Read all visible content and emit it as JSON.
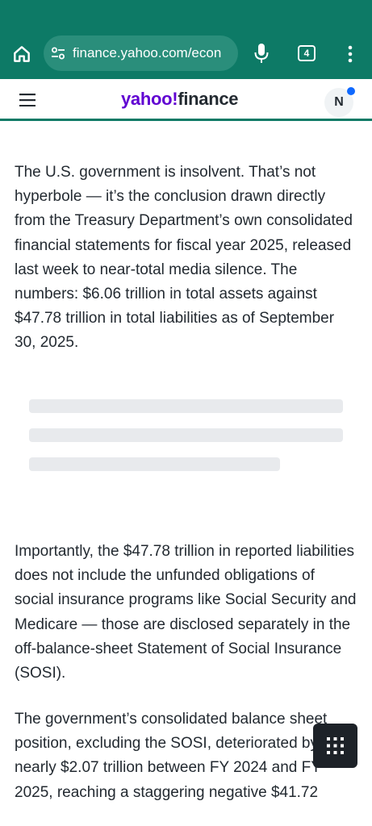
{
  "browser": {
    "url": "finance.yahoo.com/econ",
    "tab_count": "4",
    "icons": [
      "home-icon",
      "site-settings-icon",
      "microphone-icon",
      "tabs-icon",
      "more-vert-icon"
    ],
    "toolbar_color": "#0d7a66"
  },
  "site": {
    "logo_yahoo": "yahoo!",
    "logo_finance": "finance",
    "avatar_initial": "N",
    "brand_color": "#6001d2",
    "icons": [
      "hamburger-menu-icon"
    ]
  },
  "article": {
    "paragraphs": [
      "The U.S. government is insolvent. That’s not hyperbole — it’s the conclusion drawn directly from the Treasury Department’s own consolidated financial statements for fiscal year 2025, released last week to near-total media silence. The numbers: $6.06 trillion in total assets against $47.78 trillion in total liabilities as of September 30, 2025.",
      "Importantly, the $47.78 trillion in reported liabilities does not include the unfunded obligations of social insurance programs like Social Security and Medicare — those are disclosed separately in the off-balance-sheet Statement of Social Insurance (SOSI).",
      "The government’s consolidated balance sheet position, excluding the SOSI, deteriorated by nearly $2.07 trillion between FY 2024 and FY 2025, reaching a staggering negative $41.72"
    ],
    "loading_placeholder_lines": 3
  },
  "floating_button": {
    "icon": "grid-apps-icon"
  }
}
